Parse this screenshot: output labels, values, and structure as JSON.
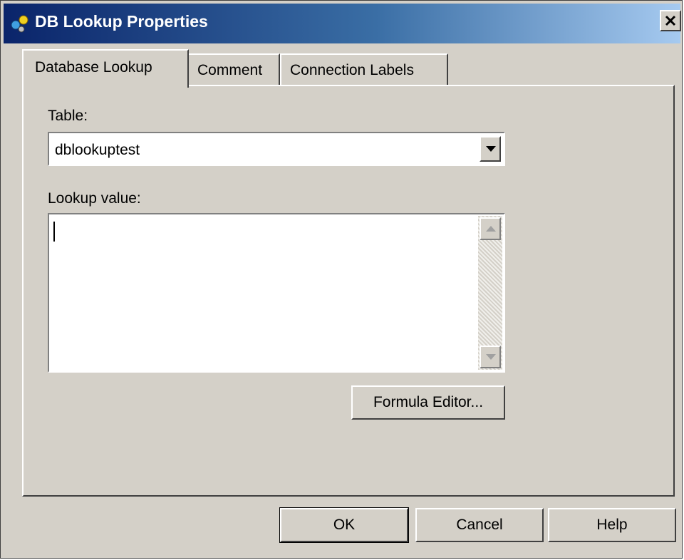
{
  "window": {
    "title": "DB Lookup Properties",
    "icon": "db-lookup-icon",
    "close_icon": "close-icon"
  },
  "tabs": [
    {
      "label": "Database Lookup",
      "active": true
    },
    {
      "label": "Comment",
      "active": false
    },
    {
      "label": "Connection Labels",
      "active": false
    }
  ],
  "form": {
    "table_label": "Table:",
    "table_value": "dblookuptest",
    "lookup_label": "Lookup value:",
    "lookup_value": "",
    "formula_editor_label": "Formula Editor..."
  },
  "buttons": {
    "ok": "OK",
    "cancel": "Cancel",
    "help": "Help"
  },
  "colors": {
    "title_gradient_start": "#0a246a",
    "title_gradient_end": "#a6caf0",
    "face": "#d4d0c8"
  }
}
